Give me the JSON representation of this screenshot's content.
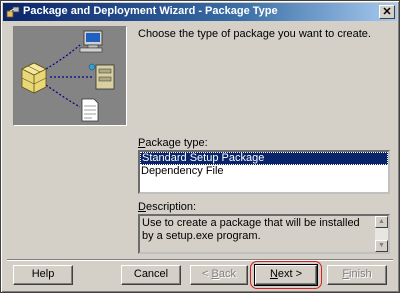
{
  "window": {
    "title": "Package and Deployment Wizard - Package Type",
    "close_label": "✕"
  },
  "prompt": "Choose the type of package you want to create.",
  "package_type": {
    "label_pre": "",
    "label_accel": "P",
    "label_post": "ackage type:",
    "items": [
      {
        "label": "Standard Setup Package",
        "selected": true
      },
      {
        "label": "Dependency File",
        "selected": false
      }
    ]
  },
  "description": {
    "label_pre": "",
    "label_accel": "D",
    "label_post": "escription:",
    "text": "Use to create a package that will be installed by a setup.exe program."
  },
  "buttons": {
    "help": "Help",
    "cancel": "Cancel",
    "back_pre": "< ",
    "back_accel": "B",
    "back_post": "ack",
    "next_pre": "",
    "next_accel": "N",
    "next_post": "ext >",
    "finish_pre": "",
    "finish_accel": "F",
    "finish_post": "inish"
  },
  "icons": {
    "title": "wizard-icon",
    "picture": [
      "package-box-icon",
      "computer-icon",
      "server-icon",
      "document-icon"
    ]
  },
  "colors": {
    "titlebar": "#0a246a",
    "selection": "#0a246a",
    "dialog": "#d4d0c8",
    "highlight_ring": "#d02020"
  }
}
